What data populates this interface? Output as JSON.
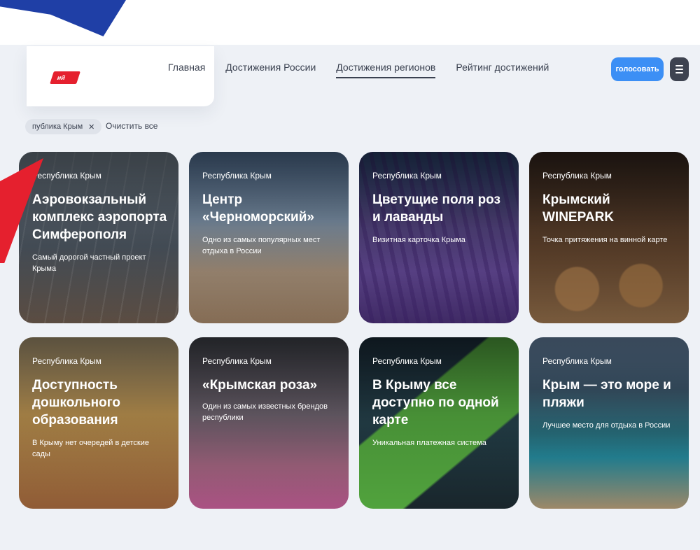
{
  "nav": {
    "items": [
      "Главная",
      "Достижения России",
      "Достижения регионов",
      "Рейтинг достижений"
    ],
    "active_index": 2
  },
  "header": {
    "vote_label": "голосовать",
    "logo_text": "ий"
  },
  "filters": {
    "chip_label": "публика Крым",
    "clear_label": "Очистить все"
  },
  "colors": {
    "accent": "#3c8ff5",
    "flag_red": "#e5202e",
    "flag_blue": "#1f3fa6",
    "menu_button": "#3e4350"
  },
  "cards": [
    {
      "region": "Республика Крым",
      "title": "Аэровокзальный комплекс аэропорта Симферополя",
      "description": "Самый дорогой частный проект Крыма"
    },
    {
      "region": "Республика Крым",
      "title": "Центр «Черноморский»",
      "description": "Одно из самых популярных мест отдыха в России"
    },
    {
      "region": "Республика Крым",
      "title": "Цветущие поля роз и лаванды",
      "description": "Визитная карточка Крыма"
    },
    {
      "region": "Республика Крым",
      "title": "Крымский WINEPARK",
      "description": "Точка притяжения на винной карте"
    },
    {
      "region": "Республика Крым",
      "title": "Доступность дошкольного образования",
      "description": "В Крыму нет очередей в детские сады"
    },
    {
      "region": "Республика Крым",
      "title": "«Крымская роза»",
      "description": "Один из самых известных брендов республики"
    },
    {
      "region": "Республика Крым",
      "title": "В Крыму все доступно по одной карте",
      "description": "Уникальная платежная система"
    },
    {
      "region": "Республика Крым",
      "title": "Крым — это море и пляжи",
      "description": "Лучшее место для отдыха в России"
    }
  ]
}
